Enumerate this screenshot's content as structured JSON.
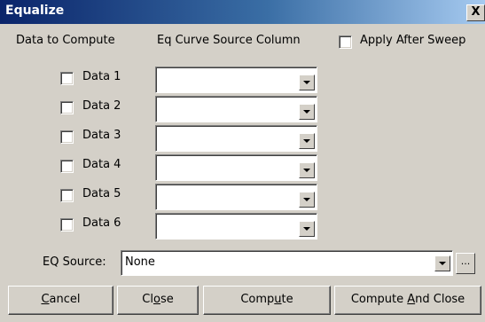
{
  "window": {
    "title": "Equalize",
    "close_glyph": "X"
  },
  "headers": {
    "data_to_compute": "Data to Compute",
    "source_column": "Eq Curve Source Column",
    "apply_after_sweep": "Apply After Sweep"
  },
  "rows": [
    {
      "label": "Data 1",
      "checked": false,
      "value": ""
    },
    {
      "label": "Data 2",
      "checked": false,
      "value": ""
    },
    {
      "label": "Data 3",
      "checked": false,
      "value": ""
    },
    {
      "label": "Data 4",
      "checked": false,
      "value": ""
    },
    {
      "label": "Data 5",
      "checked": false,
      "value": ""
    },
    {
      "label": "Data 6",
      "checked": false,
      "value": ""
    }
  ],
  "eq_source": {
    "label": "EQ Source:",
    "value": "None",
    "browse_label": "..."
  },
  "buttons": {
    "cancel": {
      "pre": "",
      "mnemonic": "C",
      "post": "ancel"
    },
    "close": {
      "pre": "Cl",
      "mnemonic": "o",
      "post": "se"
    },
    "compute": {
      "pre": "Comp",
      "mnemonic": "u",
      "post": "te"
    },
    "compute_and_close": {
      "pre": "Compute ",
      "mnemonic": "A",
      "post": "nd Close"
    }
  }
}
